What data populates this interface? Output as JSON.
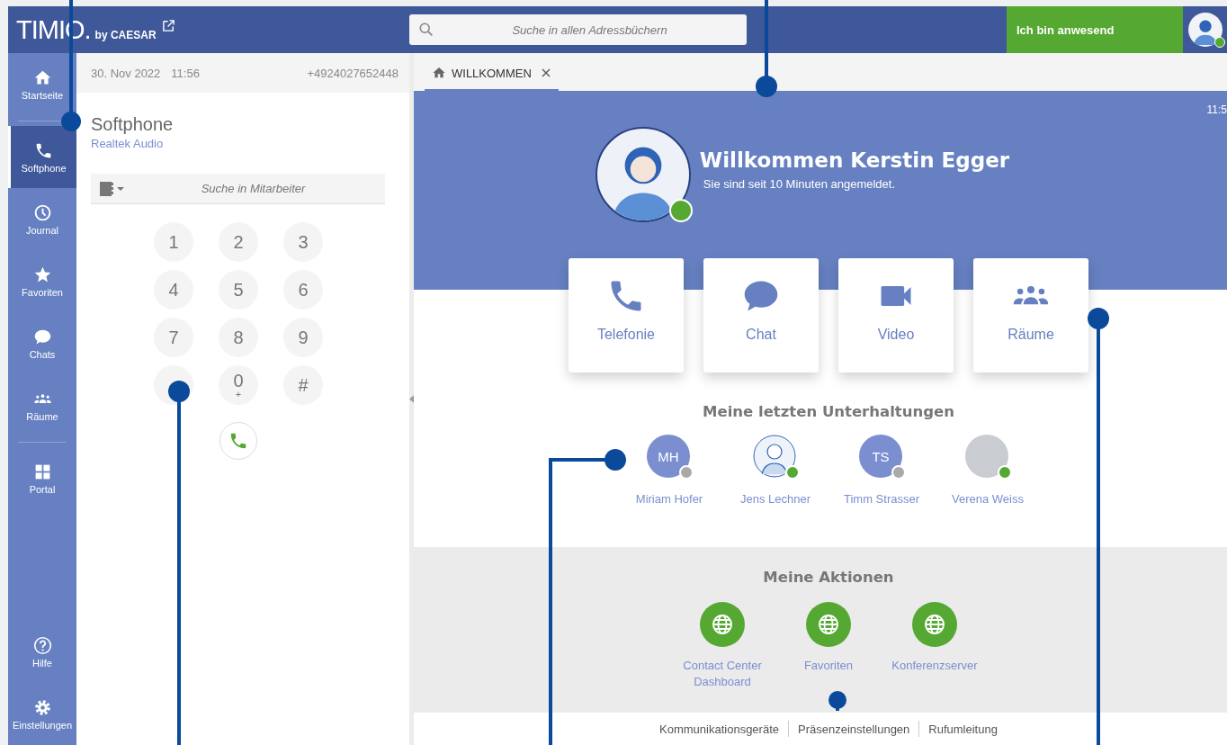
{
  "header": {
    "logo": "TIMIO.",
    "logo_suffix": "by CAESAR",
    "search": {
      "placeholder": "Suche in allen Adressbüchern"
    },
    "presence_button": "Ich bin anwesend"
  },
  "sidebar": {
    "items": [
      {
        "label": "Startseite",
        "selected": false
      },
      {
        "label": "Softphone",
        "selected": true
      },
      {
        "label": "Journal",
        "selected": false
      },
      {
        "label": "Favoriten",
        "selected": false
      },
      {
        "label": "Chats",
        "selected": false
      },
      {
        "label": "Räume",
        "selected": false
      },
      {
        "label": "Portal",
        "selected": false
      }
    ],
    "bottom_items": [
      {
        "label": "Hilfe",
        "selected": false
      },
      {
        "label": "Einstellungen",
        "selected": false
      }
    ]
  },
  "softphone": {
    "date": "30. Nov 2022",
    "time": "11:56",
    "number": "+4924027652448",
    "title": "Softphone",
    "device": "Realtek Audio",
    "search": {
      "placeholder": "Suche in Mitarbeiter"
    },
    "keys": [
      {
        "digit": "1"
      },
      {
        "digit": "2"
      },
      {
        "digit": "3"
      },
      {
        "digit": "4"
      },
      {
        "digit": "5"
      },
      {
        "digit": "6"
      },
      {
        "digit": "7"
      },
      {
        "digit": "8"
      },
      {
        "digit": "9"
      },
      {
        "digit": "0",
        "sub": "+"
      },
      {
        "digit": "#"
      }
    ]
  },
  "tabs": [
    {
      "label": "WILLKOMMEN",
      "selected": true
    }
  ],
  "welcome": {
    "clock": "11:5",
    "title": "Willkommen Kerstin Egger",
    "subtitle": "Sie sind seit 10 Minuten angemeldet."
  },
  "tiles": [
    {
      "label": "Telefonie"
    },
    {
      "label": "Chat"
    },
    {
      "label": "Video"
    },
    {
      "label": "Räume"
    }
  ],
  "conversations": {
    "title": "Meine letzten Unterhaltungen",
    "people": [
      {
        "name": "Miriam Hofer",
        "kind": "initials",
        "initials": "MH",
        "color": "#a9a9a9"
      },
      {
        "name": "Jens Lechner",
        "kind": "illustration",
        "color": "#55a832"
      },
      {
        "name": "Timm Strasser",
        "kind": "initials",
        "initials": "TS",
        "color": "#a9a9a9"
      },
      {
        "name": "Verena Weiss",
        "kind": "photo",
        "color": "#55a832"
      }
    ]
  },
  "actions": {
    "title": "Meine Aktionen",
    "items": [
      {
        "label": "Contact Center Dashboard"
      },
      {
        "label": "Favoriten"
      },
      {
        "label": "Konferenzserver"
      }
    ]
  },
  "footer_links": [
    "Kommunikationsgeräte",
    "Präsenzeinstellungen",
    "Rufumleitung"
  ]
}
